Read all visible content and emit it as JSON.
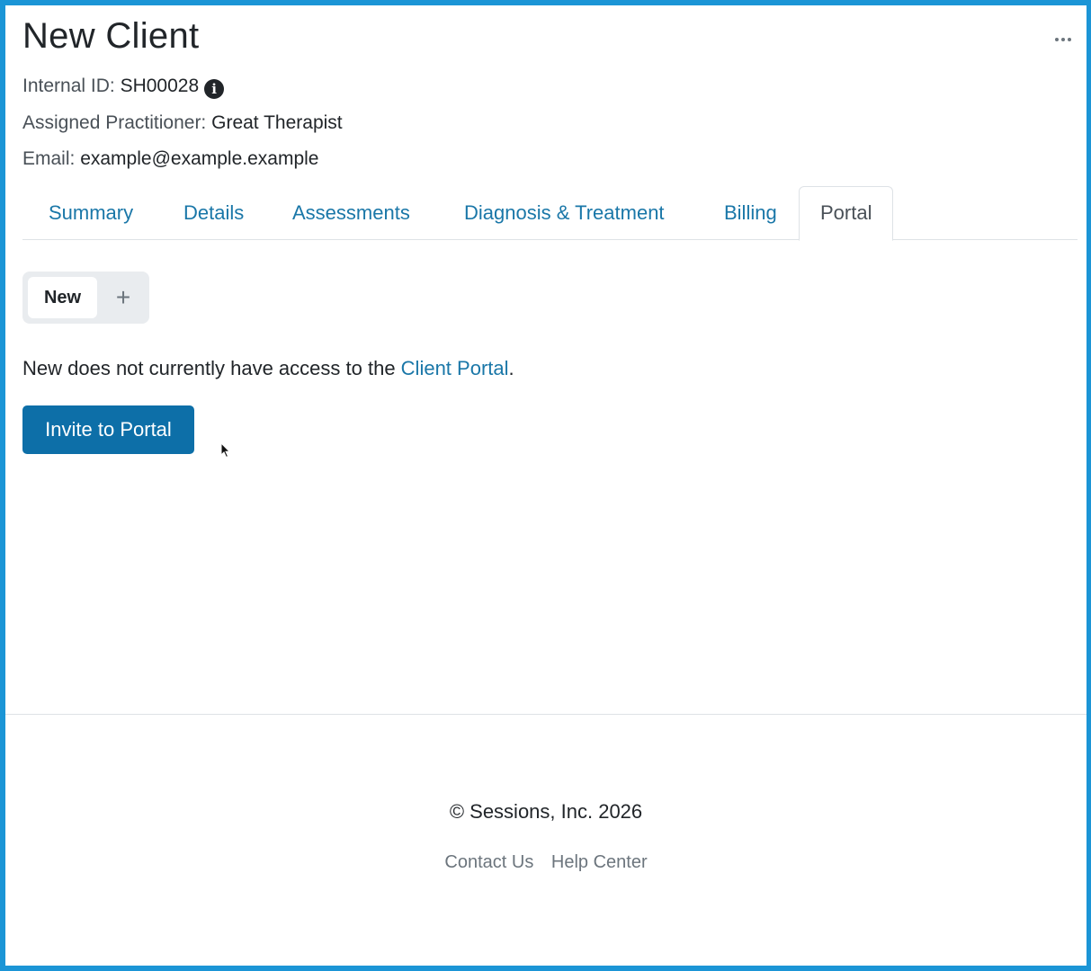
{
  "page": {
    "title": "New Client",
    "more_icon": "ellipsis-icon"
  },
  "client": {
    "internal_id_label": "Internal ID:",
    "internal_id": "SH00028",
    "info_icon": "info-circle-icon",
    "practitioner_label": "Assigned Practitioner:",
    "practitioner": "Great Therapist",
    "email_label": "Email:",
    "email": "example@example.example"
  },
  "tabs": [
    {
      "label": "Summary",
      "active": false
    },
    {
      "label": "Details",
      "active": false
    },
    {
      "label": "Assessments",
      "active": false
    },
    {
      "label": "Diagnosis & Treatment",
      "active": false
    },
    {
      "label": "Billing",
      "active": false
    },
    {
      "label": "Portal",
      "active": true
    }
  ],
  "portal": {
    "contact_pill": "New",
    "add_label": "+",
    "access_prefix": "New does not currently have access to the ",
    "access_link": "Client Portal",
    "access_suffix": ".",
    "invite_button": "Invite to Portal"
  },
  "footer": {
    "copyright": "© Sessions, Inc. 2026",
    "links": [
      "Contact Us",
      "Help Center"
    ]
  },
  "colors": {
    "frame": "#1b95d6",
    "link": "#1a77a8",
    "primary_button": "#0d6fa8"
  }
}
